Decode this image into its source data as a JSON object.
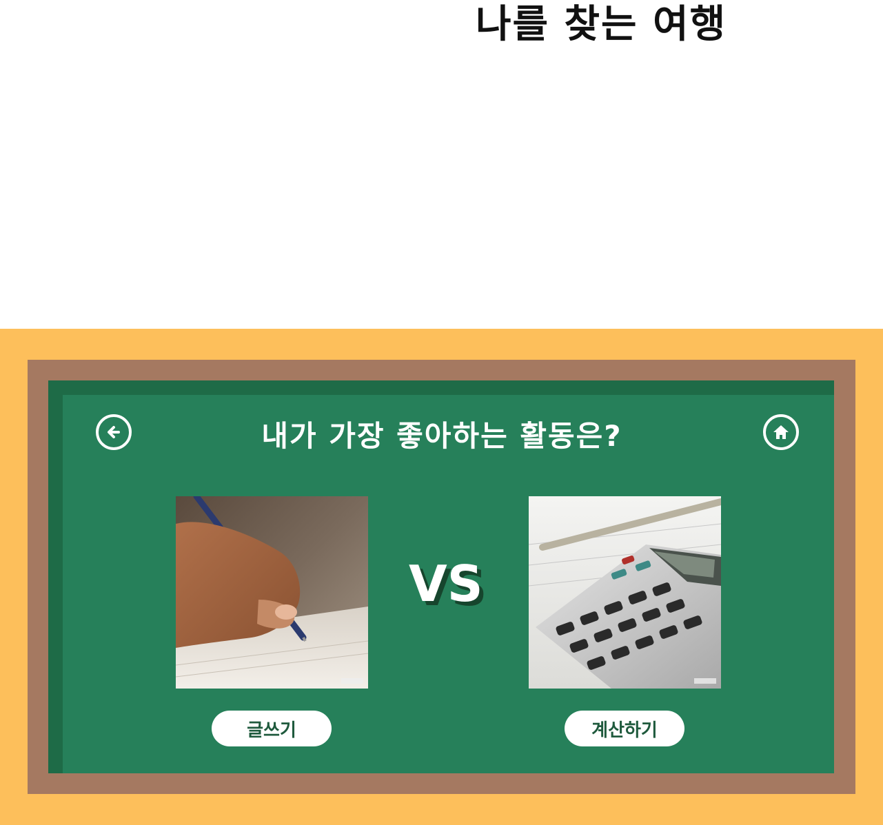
{
  "app": {
    "title": "나를 찾는 여행"
  },
  "board": {
    "question": "내가 가장 좋아하는 활동은?",
    "vs_label": "VS",
    "nav": {
      "back_icon": "arrow-left-circle-icon",
      "home_icon": "home-circle-icon"
    },
    "choices": [
      {
        "label": "글쓰기",
        "image": "writing-hand-pen-photo"
      },
      {
        "label": "계산하기",
        "image": "calculator-pen-photo"
      }
    ]
  },
  "colors": {
    "frame_outer": "#fdbf5b",
    "frame_wood": "#a57961",
    "board_dark": "#1e6b47",
    "board": "#26805a",
    "button_text": "#1f5a3d"
  }
}
